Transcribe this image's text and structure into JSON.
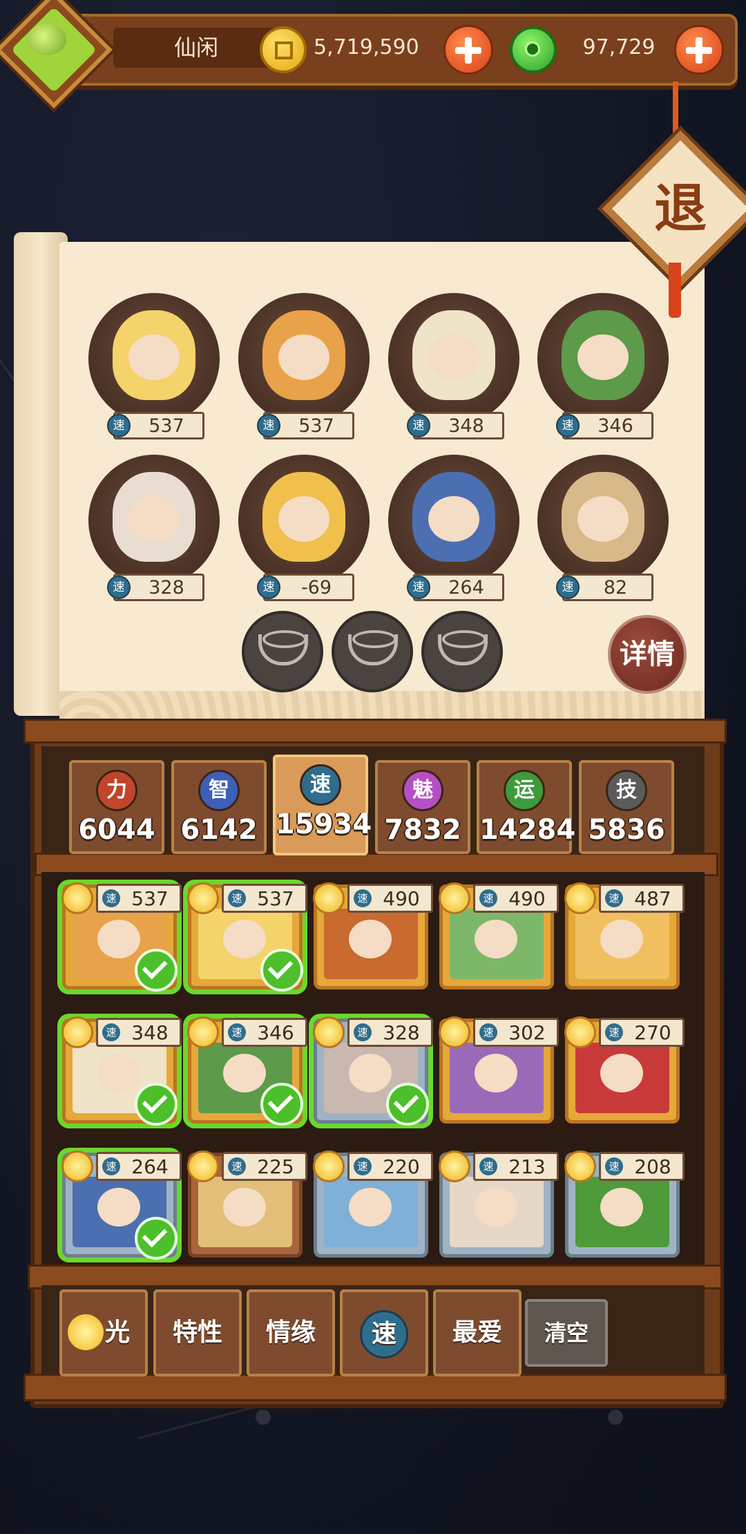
{
  "header": {
    "nickname": "仙闲",
    "gold": "5,719,590",
    "jade": "97,729",
    "exit_label": "退"
  },
  "team": {
    "slots": [
      {
        "speed": "537",
        "color": "#f3d36a"
      },
      {
        "speed": "537",
        "color": "#e8a24a"
      },
      {
        "speed": "348",
        "color": "#efe3c8"
      },
      {
        "speed": "346",
        "color": "#5d9a4a"
      },
      {
        "speed": "328",
        "color": "#e8ddd0"
      },
      {
        "speed": "-69",
        "color": "#f1c04c"
      },
      {
        "speed": "264",
        "color": "#4b6fb0"
      },
      {
        "speed": "82",
        "color": "#d8b98a"
      }
    ],
    "speed_icon": "速",
    "detail_label": "详情"
  },
  "attributes": [
    {
      "icon": "力",
      "value": "6044",
      "color": "#c0452a"
    },
    {
      "icon": "智",
      "value": "6142",
      "color": "#3d5fb8"
    },
    {
      "icon": "速",
      "value": "15934",
      "color": "#2f6d8c",
      "active": true
    },
    {
      "icon": "魅",
      "value": "7832",
      "color": "#b74fc4"
    },
    {
      "icon": "运",
      "value": "14284",
      "color": "#3f9a3a"
    },
    {
      "icon": "技",
      "value": "5836",
      "color": "#5b5b5b"
    }
  ],
  "heroes": [
    {
      "speed": "537",
      "frame": "gold",
      "selected": true,
      "color": "#e8a24a"
    },
    {
      "speed": "537",
      "frame": "gold",
      "selected": true,
      "color": "#f3d36a"
    },
    {
      "speed": "490",
      "frame": "gold",
      "selected": false,
      "color": "#c96a2f"
    },
    {
      "speed": "490",
      "frame": "gold",
      "selected": false,
      "color": "#7db86a"
    },
    {
      "speed": "487",
      "frame": "gold",
      "selected": false,
      "color": "#f0c060"
    },
    {
      "speed": "348",
      "frame": "gold",
      "selected": true,
      "color": "#efe3c8"
    },
    {
      "speed": "346",
      "frame": "gold",
      "selected": true,
      "color": "#5d9a4a"
    },
    {
      "speed": "328",
      "frame": "silver",
      "selected": true,
      "color": "#c8b8b0"
    },
    {
      "speed": "302",
      "frame": "gold",
      "selected": false,
      "color": "#9a6ab8"
    },
    {
      "speed": "270",
      "frame": "gold",
      "selected": false,
      "color": "#c83a3a"
    },
    {
      "speed": "264",
      "frame": "silver",
      "selected": true,
      "color": "#4b6fb0"
    },
    {
      "speed": "225",
      "frame": "bronze",
      "selected": false,
      "color": "#e2c07a"
    },
    {
      "speed": "220",
      "frame": "silver",
      "selected": false,
      "color": "#7fb0d8"
    },
    {
      "speed": "213",
      "frame": "silver",
      "selected": false,
      "color": "#e6d8c8"
    },
    {
      "speed": "208",
      "frame": "silver",
      "selected": false,
      "color": "#4f9a3a"
    }
  ],
  "filters": {
    "light": "光",
    "traits": "特性",
    "bond": "情缘",
    "speed": "速",
    "favorite": "最爱",
    "clear": "清空"
  }
}
